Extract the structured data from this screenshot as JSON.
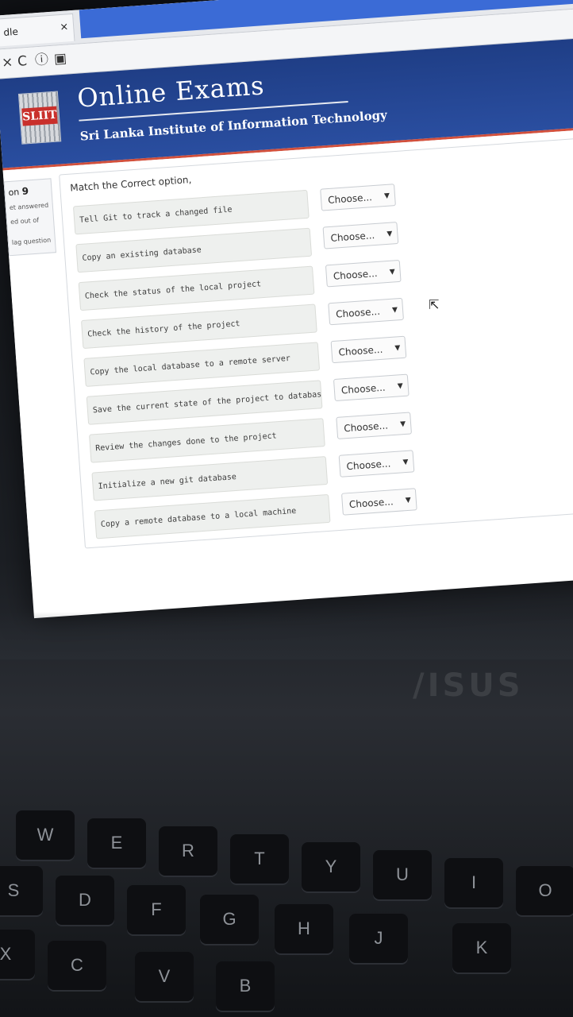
{
  "browser": {
    "tab_title": "dle",
    "tab_close": "×",
    "nav": {
      "stop": "×",
      "reload": "C",
      "info": "ⓘ",
      "page": "▣"
    }
  },
  "header": {
    "logo_text": "SLIIT",
    "title": "Online Exams",
    "subtitle": "Sri Lanka Institute of Information Technology"
  },
  "sidebar": {
    "question_prefix": "on",
    "question_number": "9",
    "status": "et answered",
    "marks": "ed out of",
    "flag": "lag question"
  },
  "question": {
    "prompt": "Match the Correct option,",
    "rows": [
      {
        "stem": "Tell Git to track a changed file",
        "choice": "Choose..."
      },
      {
        "stem": "Copy an existing database",
        "choice": "Choose..."
      },
      {
        "stem": "Check the status of the local project",
        "choice": "Choose..."
      },
      {
        "stem": "Check the history of the project",
        "choice": "Choose..."
      },
      {
        "stem": "Copy the local database to a remote server",
        "choice": "Choose..."
      },
      {
        "stem": "Save the current state of the project to database",
        "choice": "Choose..."
      },
      {
        "stem": "Review the changes done to the project",
        "choice": "Choose..."
      },
      {
        "stem": "Initialize a new git database",
        "choice": "Choose..."
      },
      {
        "stem": "Copy a remote database to a local machine",
        "choice": "Choose..."
      }
    ],
    "dropdown_arrow": "▼"
  },
  "laptop": {
    "brand": "/ISUS"
  },
  "keyboard": {
    "keys": [
      "W",
      "E",
      "R",
      "T",
      "Y",
      "U",
      "I",
      "O",
      "S",
      "D",
      "F",
      "G",
      "H",
      "J",
      "K",
      "X",
      "C",
      "V",
      "B"
    ]
  },
  "colors": {
    "header_blue": "#1f3e86",
    "accent_red": "#d2503c",
    "tab_blue": "#3b6bd6"
  }
}
